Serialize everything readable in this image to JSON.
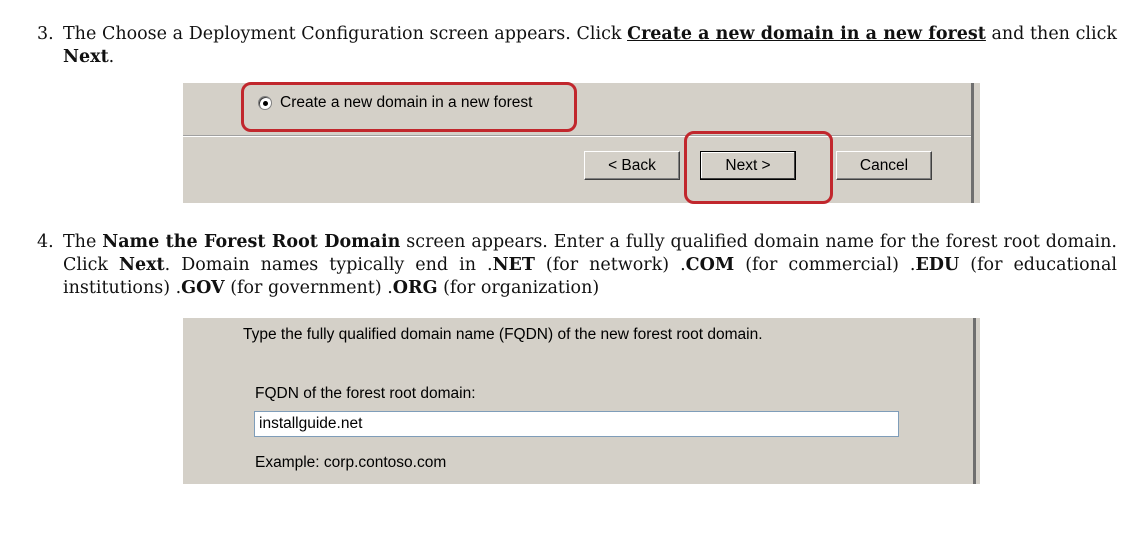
{
  "step3": {
    "number": "3.",
    "line_a": "The Choose a Deployment Configuration screen appears. Click ",
    "link": "Create a new domain in a new forest",
    "line_b": " and then click ",
    "next_word": "Next",
    "end": "."
  },
  "screenshot1": {
    "radio_label": "Create a new domain in a new forest",
    "radio_selected": true,
    "back_label": "< Back",
    "next_label": "Next >",
    "cancel_label": "Cancel"
  },
  "step4": {
    "number": "4.",
    "t1": "The ",
    "screen_name": "Name the Forest Root Domain",
    "t2": " screen appears. Enter a fully qualified domain name for the forest root domain. Click ",
    "next_word": "Next",
    "t3": ". Domain names typically end in .",
    "net": "NET",
    "t4": " (for network) .",
    "com": "COM",
    "t5": " (for commercial) .",
    "edu": "EDU",
    "t6": " (for educational institutions) .",
    "gov": "GOV",
    "t7": " (for government) .",
    "org": "ORG",
    "t8": " (for organization)"
  },
  "screenshot2": {
    "description": "Type the fully qualified domain name (FQDN) of the new forest root domain.",
    "fqdn_label": "FQDN of the forest root domain:",
    "fqdn_value": "installguide.net",
    "example": "Example: corp.contoso.com"
  },
  "colors": {
    "dialog_bg": "#d4d0c8",
    "callout": "#c1272d"
  }
}
